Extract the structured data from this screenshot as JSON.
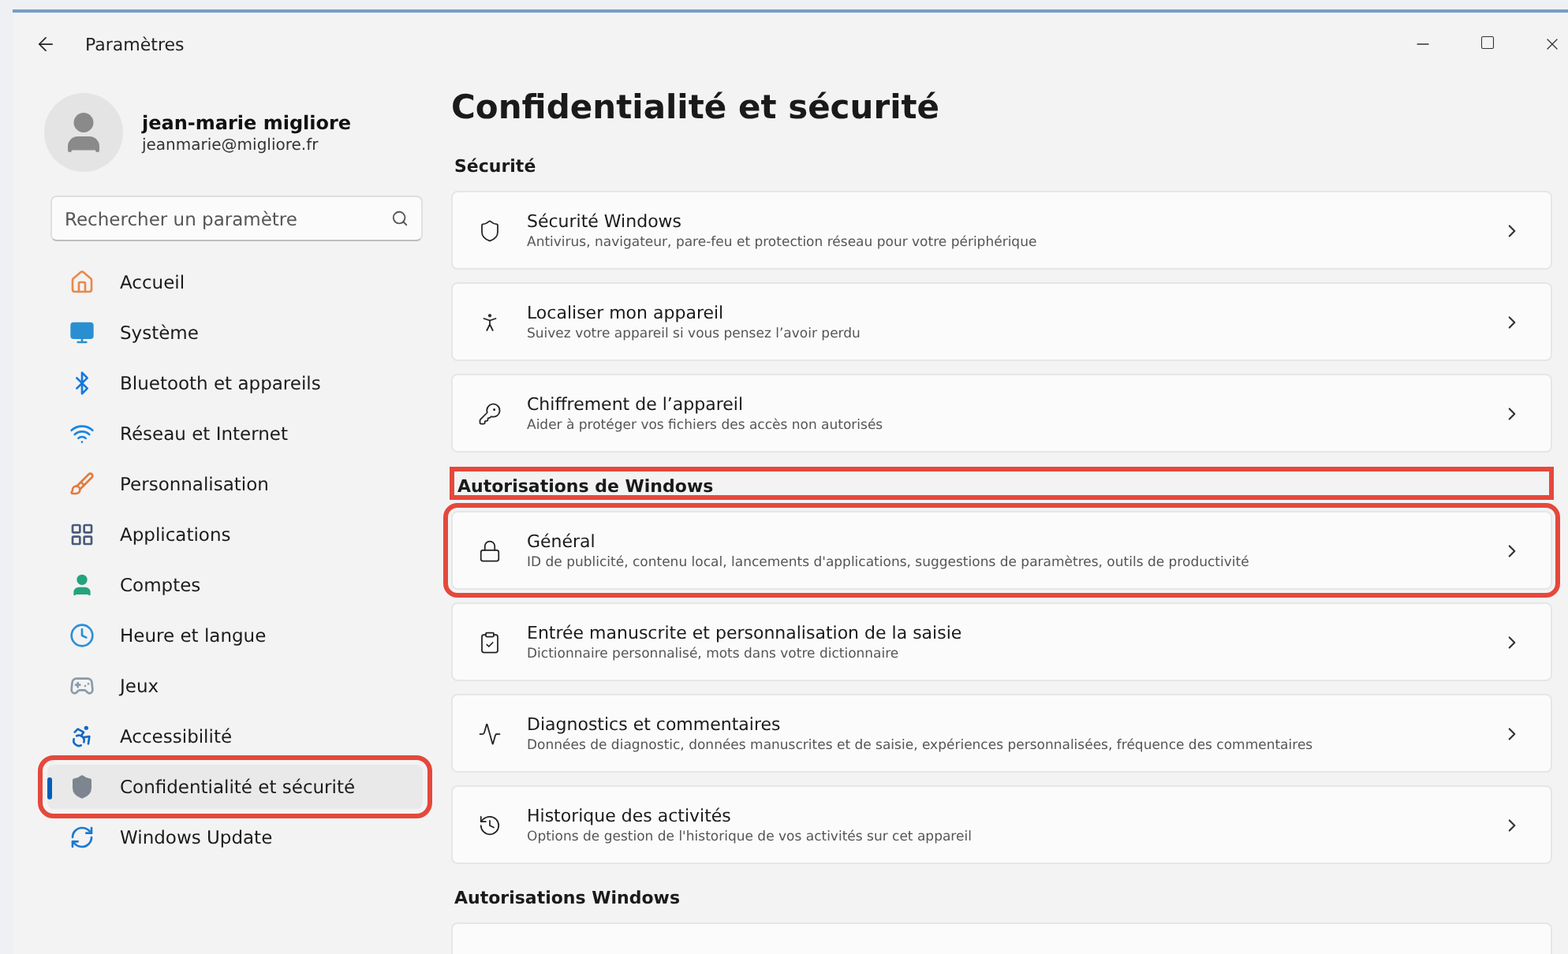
{
  "window": {
    "title": "Paramètres"
  },
  "profile": {
    "name": "jean-marie migliore",
    "email": "jeanmarie@migliore.fr"
  },
  "search": {
    "placeholder": "Rechercher un paramètre"
  },
  "sidebar": {
    "items": [
      {
        "label": "Accueil",
        "selected": false,
        "highlighted": false
      },
      {
        "label": "Système",
        "selected": false,
        "highlighted": false
      },
      {
        "label": "Bluetooth et appareils",
        "selected": false,
        "highlighted": false
      },
      {
        "label": "Réseau et Internet",
        "selected": false,
        "highlighted": false
      },
      {
        "label": "Personnalisation",
        "selected": false,
        "highlighted": false
      },
      {
        "label": "Applications",
        "selected": false,
        "highlighted": false
      },
      {
        "label": "Comptes",
        "selected": false,
        "highlighted": false
      },
      {
        "label": "Heure et langue",
        "selected": false,
        "highlighted": false
      },
      {
        "label": "Jeux",
        "selected": false,
        "highlighted": false
      },
      {
        "label": "Accessibilité",
        "selected": false,
        "highlighted": false
      },
      {
        "label": "Confidentialité et sécurité",
        "selected": true,
        "highlighted": true
      },
      {
        "label": "Windows Update",
        "selected": false,
        "highlighted": false
      }
    ]
  },
  "page_title": "Confidentialité et sécurité",
  "sections": [
    {
      "heading": "Sécurité",
      "highlighted": false,
      "cards": [
        {
          "title": "Sécurité Windows",
          "description": "Antivirus, navigateur, pare-feu et protection réseau pour votre périphérique"
        },
        {
          "title": "Localiser mon appareil",
          "description": "Suivez votre appareil si vous pensez l’avoir perdu"
        },
        {
          "title": "Chiffrement de l’appareil",
          "description": "Aider à protéger vos fichiers des accès non autorisés"
        }
      ]
    },
    {
      "heading": "Autorisations de Windows",
      "highlighted": true,
      "cards": [
        {
          "title": "Général",
          "description": "ID de publicité, contenu local, lancements d'applications, suggestions de paramètres, outils de productivité"
        },
        {
          "title": "Entrée manuscrite et personnalisation de la saisie",
          "description": "Dictionnaire personnalisé, mots dans votre dictionnaire"
        },
        {
          "title": "Diagnostics et commentaires",
          "description": "Données de diagnostic, données manuscrites et de saisie, expériences personnalisées, fréquence des commentaires"
        },
        {
          "title": "Historique des activités",
          "description": "Options de gestion de l'historique de vos activités sur cet appareil"
        }
      ]
    },
    {
      "heading": "Autorisations Windows",
      "highlighted": false,
      "cards": [
        {
          "kind": "empty"
        }
      ]
    }
  ]
}
